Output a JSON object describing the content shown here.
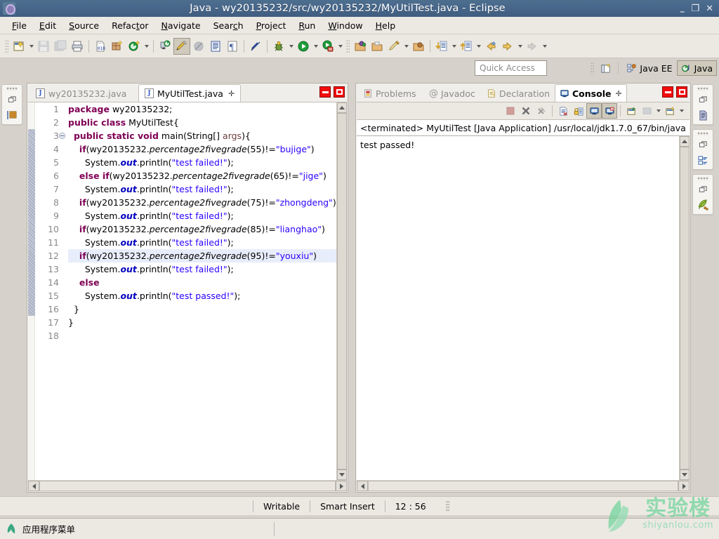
{
  "window": {
    "title": "Java - wy20135232/src/wy20135232/MyUtilTest.java - Eclipse",
    "minimize": "–",
    "maximize": "❐",
    "close": "✕",
    "app_icon": "eclipse-icon"
  },
  "menubar": {
    "items": [
      {
        "label": "File",
        "mnemonic": "F"
      },
      {
        "label": "Edit",
        "mnemonic": "E"
      },
      {
        "label": "Source",
        "mnemonic": "S"
      },
      {
        "label": "Refactor",
        "mnemonic": "t"
      },
      {
        "label": "Navigate",
        "mnemonic": "N"
      },
      {
        "label": "Search",
        "mnemonic": "c"
      },
      {
        "label": "Project",
        "mnemonic": "P"
      },
      {
        "label": "Run",
        "mnemonic": "R"
      },
      {
        "label": "Window",
        "mnemonic": "W"
      },
      {
        "label": "Help",
        "mnemonic": "H"
      }
    ]
  },
  "toolbar": {
    "buttons": [
      "new-wizard-icon",
      "save-icon",
      "save-all-icon",
      "print-icon",
      "new-java-package-icon",
      "new-java-class-icon",
      "new-annotation-icon",
      "external-tools-icon",
      "toggle-mark-occurrences-icon",
      "skip-all-breakpoints-icon",
      "open-type-icon",
      "show-whitespace-icon",
      "link-with-editor-icon",
      "debug-icon",
      "run-icon",
      "run-last-tool-icon",
      "coverage-icon",
      "new-java-project-icon",
      "open-folder-icon",
      "search-icon",
      "open-task-icon",
      "next-annotation-icon",
      "previous-annotation-icon",
      "back-icon",
      "forward-icon",
      "last-edit-icon"
    ]
  },
  "quick_access": {
    "placeholder": "Quick Access",
    "value": ""
  },
  "perspectives": {
    "open_perspective_icon": "open-perspective-icon",
    "items": [
      {
        "label": "Java EE",
        "icon": "java-ee-perspective-icon",
        "selected": false
      },
      {
        "label": "Java",
        "icon": "java-perspective-icon",
        "selected": true
      }
    ]
  },
  "fastview_left": {
    "stacks": [
      {
        "restore_icon": "restore-icon",
        "view_icon": "package-explorer-icon"
      }
    ]
  },
  "fastview_right": {
    "stacks": [
      {
        "restore_icon": "restore-icon",
        "view_icon": "outline-icon"
      },
      {
        "restore_icon": "restore-icon",
        "view_icon": "task-list-icon"
      },
      {
        "restore_icon": "restore-icon",
        "view_icon": "javadoc-icon"
      }
    ]
  },
  "editor": {
    "tabs": [
      {
        "label": "wy20135232.java",
        "icon": "java-file-icon",
        "active": false,
        "closable": false
      },
      {
        "label": "MyUtilTest.java",
        "icon": "java-file-icon",
        "active": true,
        "closable": true,
        "close_glyph": "✛"
      }
    ],
    "view_buttons": [
      {
        "name": "minimize-editor-button",
        "glyph": "minimize"
      },
      {
        "name": "maximize-editor-button",
        "glyph": "maximize"
      }
    ],
    "highlighted_line": 12,
    "folded_marker_line": 3,
    "lines": [
      {
        "n": 1,
        "html": "<span class=\"kw\">package</span> wy20135232;"
      },
      {
        "n": 2,
        "html": "<span class=\"kw\">public class</span> MyUtilTest{"
      },
      {
        "n": 3,
        "html": "  <span class=\"kw\">public static void</span> main(String[] <span class=\"prm\">args</span>){"
      },
      {
        "n": 4,
        "html": "    <span class=\"kw\">if</span>(wy20135232.<span class=\"mth\">percentage2fivegrade</span>(55)!=<span class=\"str\">\"bujige\"</span>)"
      },
      {
        "n": 5,
        "html": "      System.<span class=\"fld\">out</span>.println(<span class=\"str\">\"test failed!\"</span>);"
      },
      {
        "n": 6,
        "html": "    <span class=\"kw\">else if</span>(wy20135232.<span class=\"mth\">percentage2fivegrade</span>(65)!=<span class=\"str\">\"jige\"</span>)"
      },
      {
        "n": 7,
        "html": "      System.<span class=\"fld\">out</span>.println(<span class=\"str\">\"test failed!\"</span>);"
      },
      {
        "n": 8,
        "html": "    <span class=\"kw\">if</span>(wy20135232.<span class=\"mth\">percentage2fivegrade</span>(75)!=<span class=\"str\">\"zhongdeng\"</span>)"
      },
      {
        "n": 9,
        "html": "      System.<span class=\"fld\">out</span>.println(<span class=\"str\">\"test failed!\"</span>);"
      },
      {
        "n": 10,
        "html": "    <span class=\"kw\">if</span>(wy20135232.<span class=\"mth\">percentage2fivegrade</span>(85)!=<span class=\"str\">\"lianghao\"</span>)"
      },
      {
        "n": 11,
        "html": "      System.<span class=\"fld\">out</span>.println(<span class=\"str\">\"test failed!\"</span>);"
      },
      {
        "n": 12,
        "html": "    <span class=\"kw\">if</span>(wy20135232.<span class=\"mth\">percentage2fivegrade</span>(95)!=<span class=\"str\">\"youxiu\"</span>)"
      },
      {
        "n": 13,
        "html": "      System.<span class=\"fld\">out</span>.println(<span class=\"str\">\"test failed!\"</span>);"
      },
      {
        "n": 14,
        "html": "    <span class=\"kw\">else</span>"
      },
      {
        "n": 15,
        "html": "      System.<span class=\"fld\">out</span>.println(<span class=\"str\">\"test passed!\"</span>);"
      },
      {
        "n": 16,
        "html": "  }"
      },
      {
        "n": 17,
        "html": "}"
      },
      {
        "n": 18,
        "html": ""
      }
    ]
  },
  "console_panel": {
    "tabs": [
      {
        "label": "Problems",
        "icon": "problems-icon",
        "active": false
      },
      {
        "label": "Javadoc",
        "icon": "javadoc-at-icon",
        "active": false
      },
      {
        "label": "Declaration",
        "icon": "declaration-icon",
        "active": false
      },
      {
        "label": "Console",
        "icon": "console-icon",
        "active": true,
        "close_glyph": "✛"
      }
    ],
    "view_buttons": [
      {
        "name": "minimize-console-button",
        "glyph": "minimize"
      },
      {
        "name": "maximize-console-button",
        "glyph": "maximize"
      }
    ],
    "toolbar_buttons": [
      "terminate-icon",
      "remove-launch-icon",
      "remove-all-terminated-icon",
      "clear-console-icon",
      "scroll-lock-icon",
      "show-console-on-output-icon",
      "show-console-on-error-icon",
      "pin-console-icon",
      "display-selected-console-icon",
      "open-console-icon"
    ],
    "header": "<terminated> MyUtilTest [Java Application] /usr/local/jdk1.7.0_67/bin/java",
    "output": "test passed!"
  },
  "statusbar": {
    "writable": "Writable",
    "insert_mode": "Smart Insert",
    "cursor_position": "12 : 56"
  },
  "taskbar": {
    "icon": "linux-mint-menu-icon",
    "label": "应用程序菜单"
  },
  "watermark": {
    "logo_icon": "shiyanlou-leaf-logo",
    "cn": "实验楼",
    "en": "shiyanlou.com",
    "color": "#6fd39a"
  },
  "colors": {
    "titlebar": "#47668a",
    "chrome": "#ece9e3",
    "desktop": "#d6d2cb",
    "keyword": "#7f0055",
    "string": "#2a00ff",
    "field": "#0000c0",
    "parameter": "#6a3e3e",
    "line_highlight": "#e8edfb",
    "view_button_red": "#f20d0d"
  }
}
